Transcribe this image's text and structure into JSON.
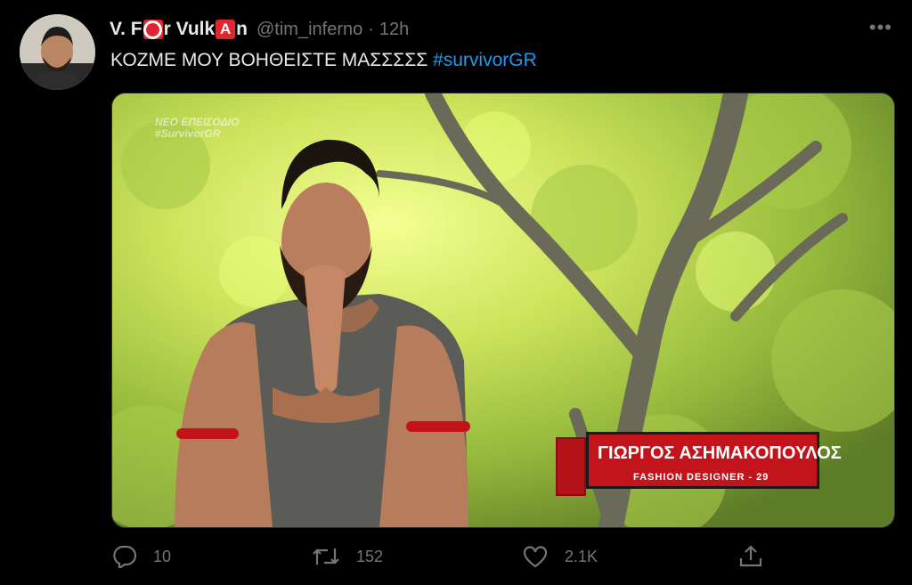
{
  "tweet": {
    "display_name_parts": [
      "V. F",
      "r Vulk",
      "n"
    ],
    "emoji_letter": "A",
    "handle": "@tim_inferno",
    "separator": "·",
    "time": "12h",
    "more_label": "•••",
    "text": "ΚΟΖΜΕ ΜΟΥ ΒΟΗΘΕΙΣΤΕ ΜΑΣΣΣΣΣ",
    "hashtag": "#survivorGR"
  },
  "media": {
    "watermark_line1": "ΝΕΟ ΕΠΕΙΣΟΔΙΟ",
    "watermark_line2": "#SurvivorGR",
    "lower_third_name": "ΓΙΩΡΓΟΣ ΑΣΗΜΑΚΟΠΟΥΛΟΣ",
    "lower_third_role": "FASHION DESIGNER - 29"
  },
  "actions": {
    "replies": "10",
    "retweets": "152",
    "likes": "2.1K"
  },
  "colors": {
    "background": "#000000",
    "text": "#e7e9ea",
    "muted": "#71767b",
    "link": "#1d9bf0",
    "accent_red": "#e0262f"
  },
  "icons": [
    "reply-icon",
    "retweet-icon",
    "like-icon",
    "share-icon",
    "more-icon"
  ]
}
